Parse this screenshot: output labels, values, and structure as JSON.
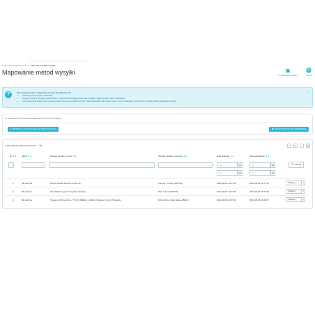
{
  "header": {
    "breadcrumb": [
      "Cenex Broker Service Pro",
      "Mapowanie metod wysyłki"
    ],
    "breadcrumb_separator": "/",
    "title": "Mapowanie metod wysyłki",
    "toolbar": [
      {
        "label": "Konfiguracja modułu",
        "icon": "puzzle-icon"
      },
      {
        "label": "Pomoc",
        "icon": "help-icon"
      }
    ]
  },
  "alert": {
    "title": "Jak zaimportować i zmapować metody wysyłki Cenex?",
    "items": [
      "Naciśnij przycisk \"Importuj i aktualizuj\"",
      "Następnie wybierz dostępną metodę Cenex w słowniku dla każdego przewoźnika w sklepie i kliknij przycisk \"Zapisz mapowanie\"",
      "Jeśli wystąpi brak dostęp nowej metody wysyłki przez Cenex to kliknij przycisk \"Importuj/Aktualizuj\" aby pobrać nowe i może je zmapować, w przeciwnym wypadku zamknij mapowanie na liście"
    ],
    "close": "×"
  },
  "import_panel": {
    "heading": "IMPORTUJ / AKTUALIZUJ METODY WYSYŁKI Z CENEX",
    "import_button": "IMPORTUJ / AKTUALIZUJ METODY WYSYŁKI",
    "delete_button": "USUŃ WSZYSTKIE MAPOWANIA"
  },
  "list_panel": {
    "heading": "MAPOWANIE METOD WYSYŁKI",
    "count": "3",
    "columns": [
      "ID",
      "Sklep",
      "Metoda dostawy Cenex",
      "Metoda dostawy w sklepie",
      "Data dodania",
      "Data aktualizacji"
    ],
    "sort_glyph": "▼▲",
    "filters": {
      "select_placeholder": "--",
      "date_from": "Od",
      "date_to": "Do",
      "search_button": "Szukaj"
    },
    "rows": [
      {
        "id": "1",
        "shop": "Mk kuchnie",
        "cenex_method": "Poczta Polska Pocztex Kurier 24",
        "shop_method": "Pocztex - Kurier (GRATIS)",
        "added": "2021-08-06 14:57:20",
        "updated": "2021-08-06 14:57:45"
      },
      {
        "id": "2",
        "shop": "Mk kuchnie",
        "cenex_method": "DHL Paletki Ligos Przesyłka kurierska",
        "shop_method": "DHL Kurier (GRATIS)",
        "added": "2021-08-06 14:57:20",
        "updated": "2021-08-06 14:57:56"
      },
      {
        "id": "3",
        "shop": "Mk kuchnie",
        "cenex_method": "Transport MO kuchnie - TYLKO MEBLE (+38km), Płatność z góry Przesyłka",
        "shop_method": "MO kuchnie (tylko Śląsk+180km)",
        "added": "2021-08-06 14:57:00",
        "updated": "2021-08-08 14:08:07"
      }
    ],
    "edit_label": "Edytuj",
    "edit_dropdown": "▾"
  },
  "colors": {
    "accent": "#25b9d7",
    "alert_bg": "#dcf4f9",
    "text": "#363a41"
  }
}
